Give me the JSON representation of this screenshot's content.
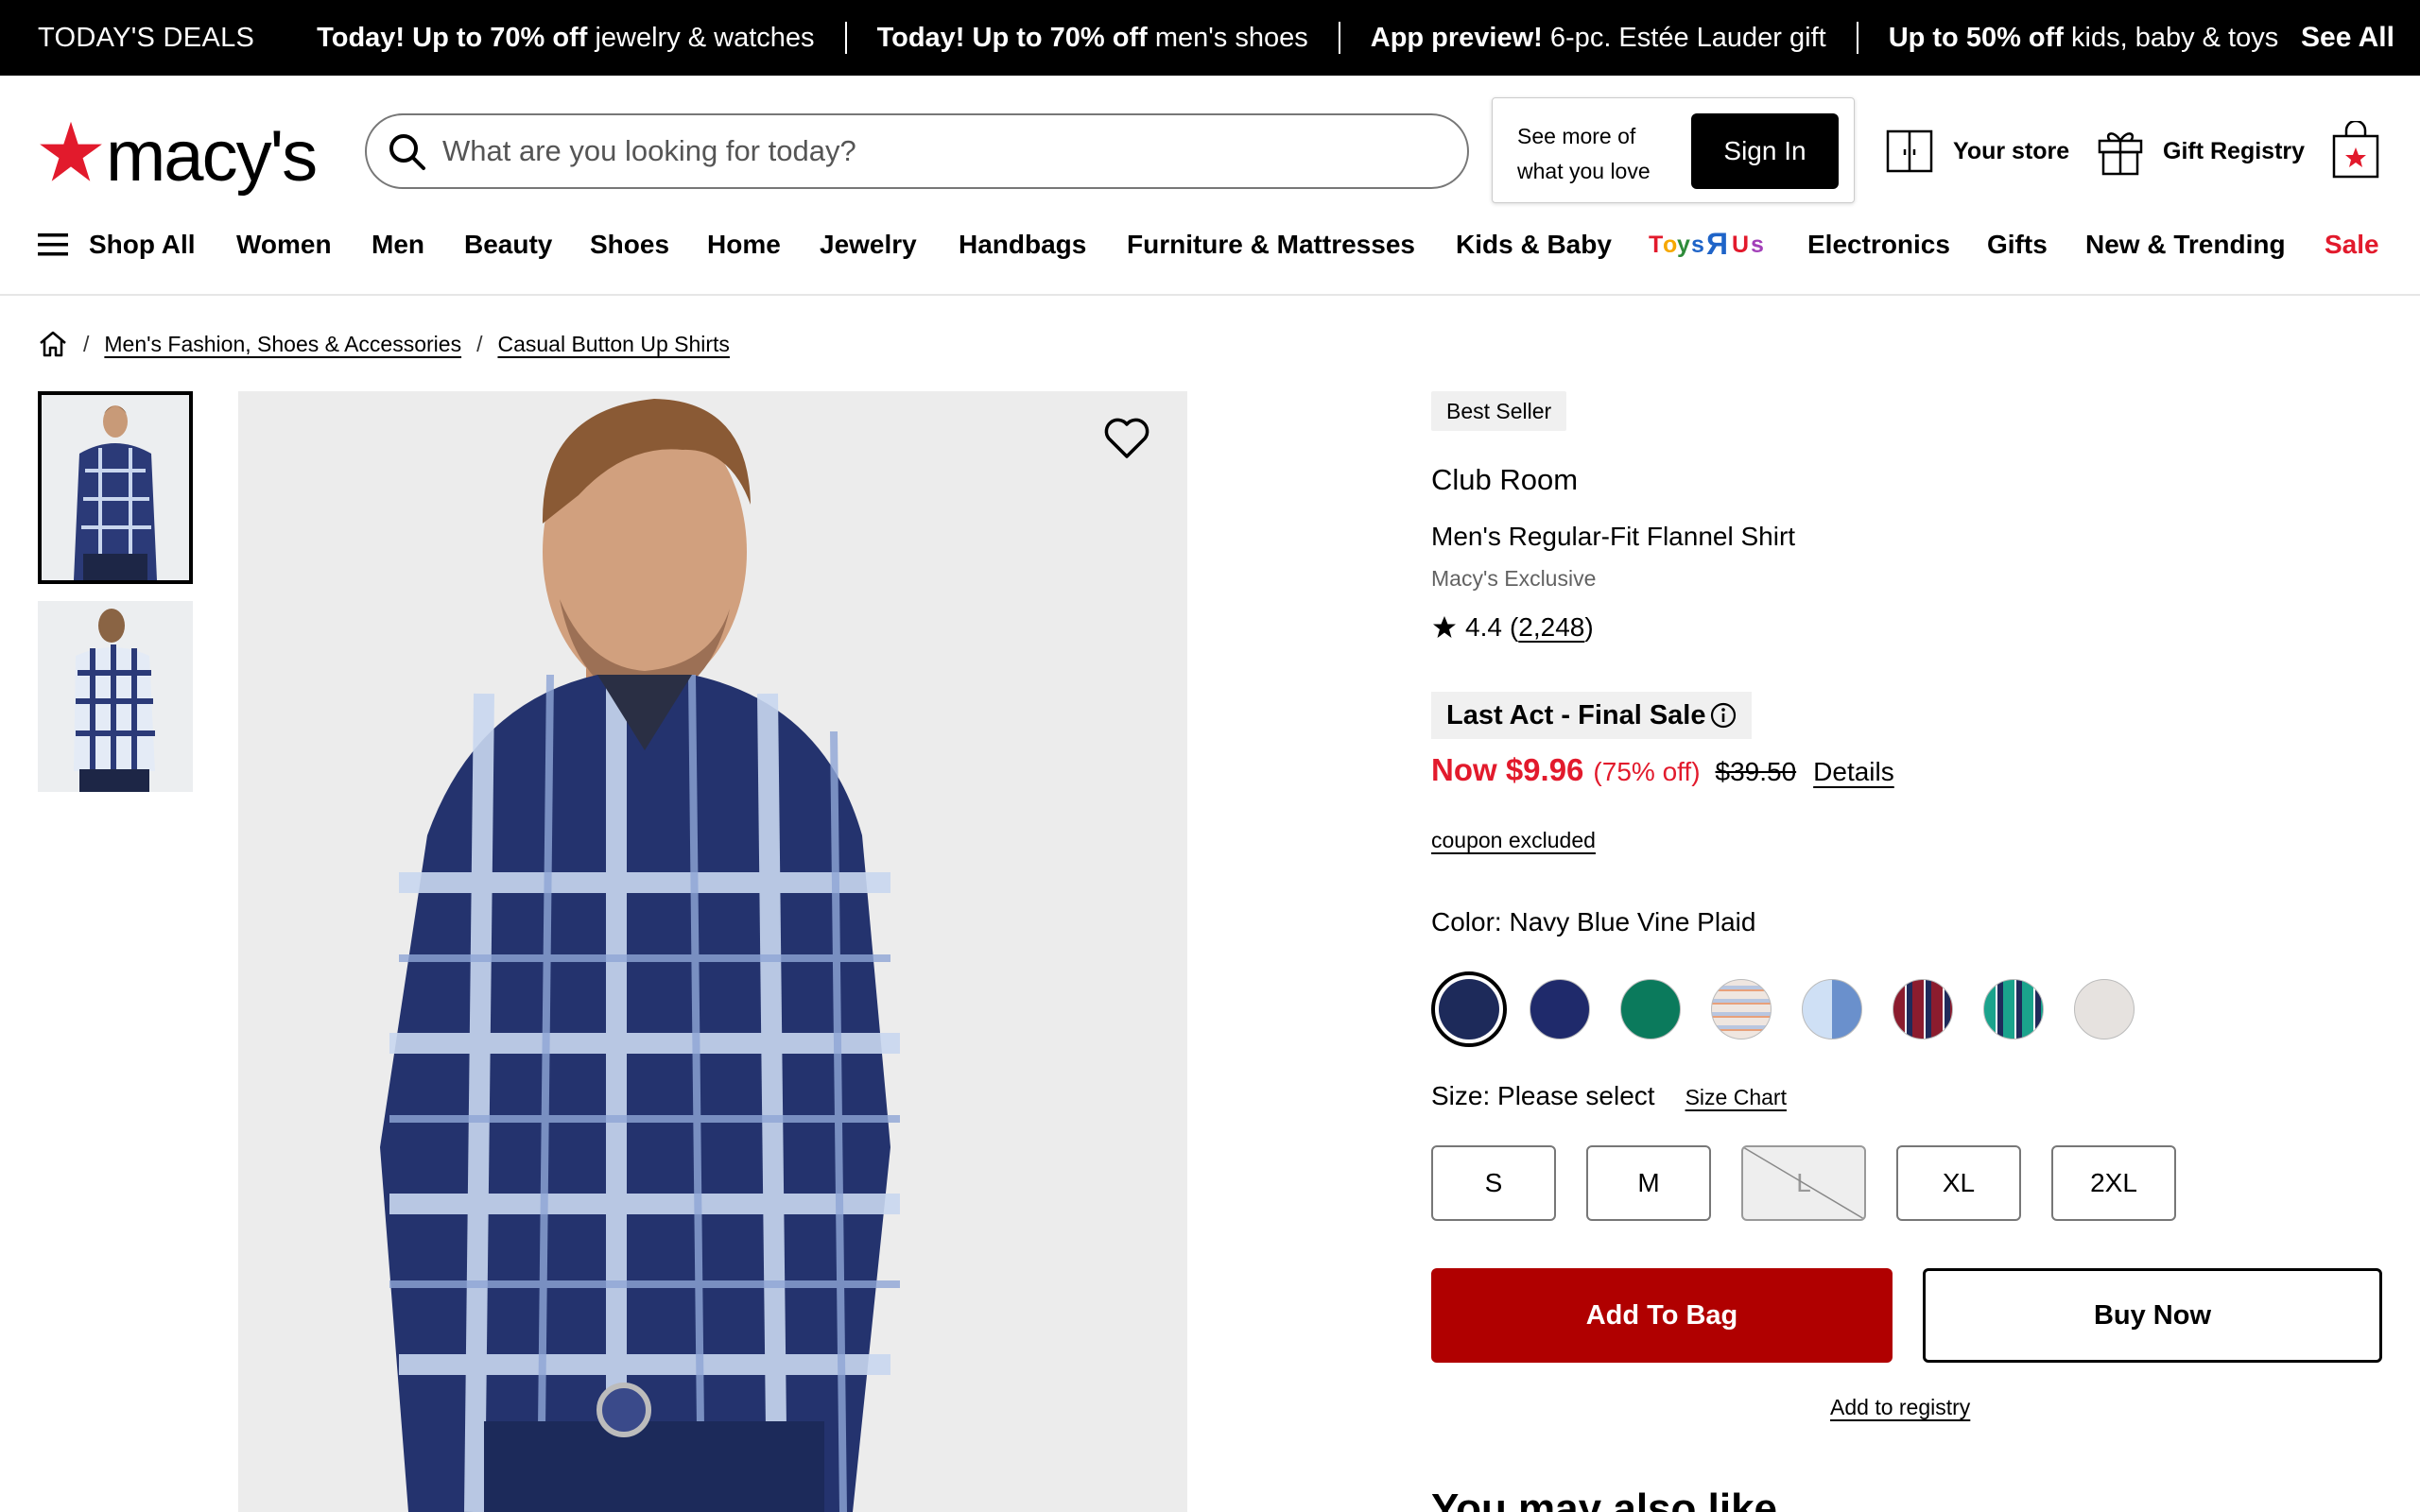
{
  "deals": {
    "lead": "TODAY'S DEALS",
    "items": [
      {
        "bold": "Today! Up to 70% off",
        "rest": " jewelry & watches"
      },
      {
        "bold": "Today! Up to 70% off",
        "rest": " men's shoes"
      },
      {
        "bold": "App preview!",
        "rest": " 6-pc. Estée Lauder gift"
      },
      {
        "bold": "Up to 50% off",
        "rest": " kids, baby & toys"
      }
    ],
    "see_all": "See All"
  },
  "header": {
    "logo_text": "macy's",
    "search_placeholder": "What are you looking for today?",
    "signin_prompt": "See more of what you love",
    "signin_button": "Sign In",
    "your_store": "Your store",
    "gift_registry": "Gift Registry"
  },
  "nav": {
    "shop_all": "Shop All",
    "items": [
      "Women",
      "Men",
      "Beauty",
      "Shoes",
      "Home",
      "Jewelry",
      "Handbags",
      "Furniture & Mattresses",
      "Kids & Baby",
      "Toys\"R\"Us",
      "Electronics",
      "Gifts",
      "New & Trending",
      "Sale"
    ]
  },
  "breadcrumb": [
    "Men's Fashion, Shoes & Accessories",
    "Casual Button Up Shirts"
  ],
  "product": {
    "badge": "Best Seller",
    "brand": "Club Room",
    "name": "Men's Regular-Fit Flannel Shirt",
    "exclusive": "Macy's Exclusive",
    "rating": "4.4",
    "review_count": "2,248",
    "promo": "Last Act - Final Sale",
    "price_now": "Now $9.96",
    "price_pct": "(75% off)",
    "price_orig": "$39.50",
    "details": "Details",
    "coupon": "coupon excluded",
    "color_label": "Color: Navy Blue Vine Plaid",
    "swatches": [
      {
        "name": "Navy Blue Vine Plaid",
        "color": "#1d2a5a",
        "selected": true
      },
      {
        "name": "Navy",
        "color": "#1f2a6b"
      },
      {
        "name": "Green",
        "color": "#0b7a5c"
      },
      {
        "name": "Tan Plaid",
        "color": "#e8d6cc"
      },
      {
        "name": "Light Blue Plaid",
        "color": "#a9c6e8"
      },
      {
        "name": "Red Plaid",
        "color": "#8b1c2e"
      },
      {
        "name": "Teal Plaid",
        "color": "#1aa38c"
      },
      {
        "name": "Light Grey",
        "color": "#e6e2df"
      }
    ],
    "size_label": "Size: Please select",
    "size_chart": "Size Chart",
    "sizes": [
      {
        "label": "S",
        "available": true
      },
      {
        "label": "M",
        "available": true
      },
      {
        "label": "L",
        "available": false
      },
      {
        "label": "XL",
        "available": true
      },
      {
        "label": "2XL",
        "available": true
      }
    ],
    "add_to_bag": "Add To Bag",
    "buy_now": "Buy Now",
    "add_to_registry": "Add to registry"
  },
  "also_like": "You may also like",
  "colors": {
    "accent_red": "#e21a2c",
    "bag_button": "#b00000"
  }
}
